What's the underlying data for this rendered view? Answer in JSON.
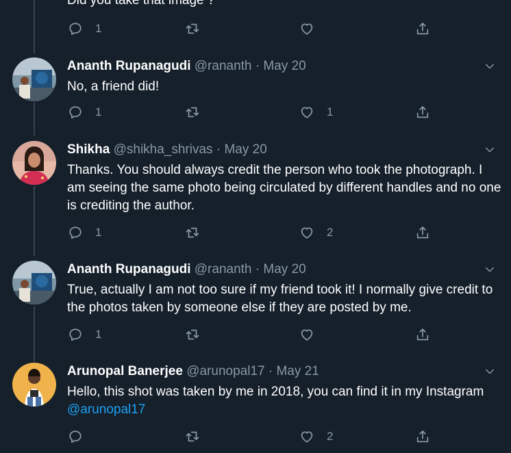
{
  "colors": {
    "background": "#15202b",
    "secondary_text": "#8899a6",
    "link": "#1da1f2",
    "thread_line": "#38444d"
  },
  "top_partial": {
    "text": "Did you take that image ?",
    "reply_count": "1",
    "retweet_count": "",
    "like_count": "",
    "icons": [
      "reply-icon",
      "retweet-icon",
      "like-icon",
      "share-icon"
    ]
  },
  "tweets": [
    {
      "name": "Ananth Rupanagudi",
      "handle": "@rananth",
      "separator": "·",
      "date": "May 20",
      "text": "No, a friend did!",
      "reply_count": "1",
      "retweet_count": "",
      "like_count": "1"
    },
    {
      "name": "Shikha",
      "handle": "@shikha_shrivas",
      "separator": "·",
      "date": "May 20",
      "text": "Thanks. You should always credit the person who took the photograph. I am seeing the same photo being circulated by different handles and no one is crediting the author.",
      "reply_count": "1",
      "retweet_count": "",
      "like_count": "2"
    },
    {
      "name": "Ananth Rupanagudi",
      "handle": "@rananth",
      "separator": "·",
      "date": "May 20",
      "text": "True, actually I am not too sure if my friend took it! I normally give credit to the photos taken by someone else if they are posted by me.",
      "reply_count": "1",
      "retweet_count": "",
      "like_count": ""
    },
    {
      "name": "Arunopal Banerjee",
      "handle": "@arunopal17",
      "separator": "·",
      "date": "May 21",
      "text": "Hello, this shot was taken by me in 2018, you can find it in my Instagram ",
      "mention": "@arunopal17",
      "reply_count": "",
      "retweet_count": "",
      "like_count": "2"
    }
  ]
}
